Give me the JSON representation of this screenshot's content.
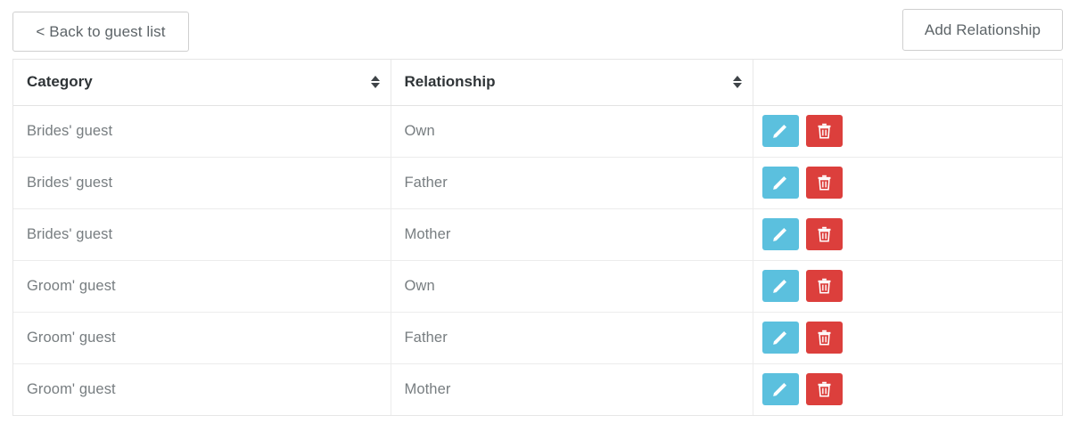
{
  "toolbar": {
    "back_label": "< Back to guest list",
    "add_label": "Add Relationship"
  },
  "table": {
    "columns": [
      {
        "label": "Category",
        "sortable": true,
        "sort_icon": "sort-updown-icon"
      },
      {
        "label": "Relationship",
        "sortable": true,
        "sort_icon": "sort-updown-icon"
      },
      {
        "label": "",
        "sortable": false
      }
    ],
    "rows": [
      {
        "category": "Brides' guest",
        "relationship": "Own"
      },
      {
        "category": "Brides' guest",
        "relationship": "Father"
      },
      {
        "category": "Brides' guest",
        "relationship": "Mother"
      },
      {
        "category": "Groom' guest",
        "relationship": "Own"
      },
      {
        "category": "Groom' guest",
        "relationship": "Father"
      },
      {
        "category": "Groom' guest",
        "relationship": "Mother"
      }
    ],
    "row_actions": {
      "edit_icon": "pencil-icon",
      "delete_icon": "trash-icon"
    }
  },
  "colors": {
    "edit_button": "#5bc0de",
    "delete_button": "#dc3f3c",
    "border": "#e6e6e6",
    "header_text": "#2f3437",
    "body_text": "#777d80",
    "button_text": "#5d6468"
  }
}
